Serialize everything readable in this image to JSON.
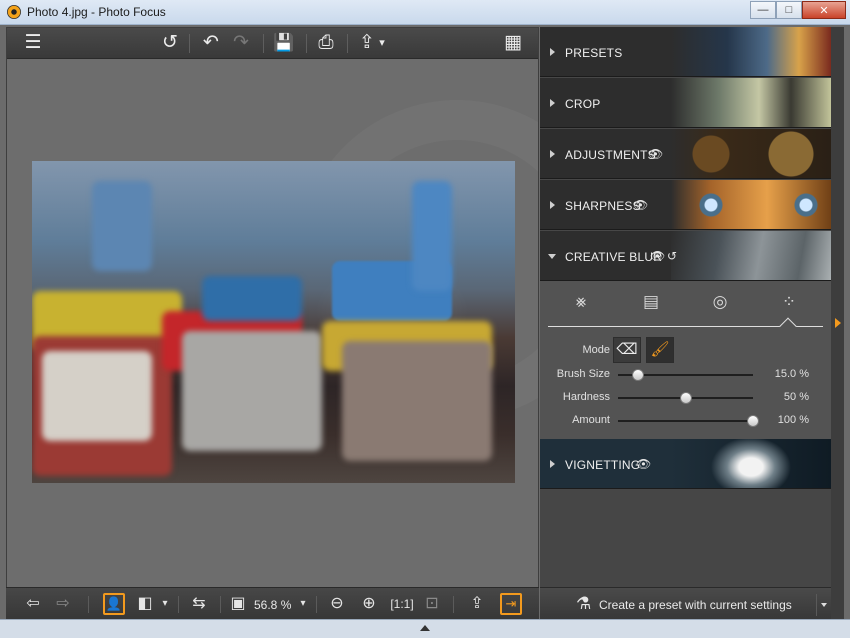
{
  "window": {
    "title": "Photo 4.jpg - Photo Focus",
    "controls": {
      "minimize": "—",
      "maximize": "□",
      "close": "✕"
    }
  },
  "toolbar": {
    "icons": [
      "menu-icon",
      "undo-all-icon",
      "undo-icon",
      "redo-icon",
      "save-icon",
      "print-icon",
      "share-icon",
      "grid-view-icon"
    ],
    "glyphs": {
      "menu": "☰",
      "undo_all": "↺",
      "undo": "↶",
      "redo": "↷",
      "save": "💾",
      "print": "⎙",
      "share": "⇪",
      "share_caret": "▾",
      "grid": "▦"
    }
  },
  "bottom_toolbar": {
    "glyphs": {
      "prev": "⇦",
      "next": "⇨",
      "person": "👤",
      "compare": "◧",
      "compare_caret": "▾",
      "split": "⇆",
      "frame": "▣",
      "zoom_caret": "▾",
      "zoom_out": "⊖",
      "zoom_in": "⊕",
      "actual": "[1:1]",
      "fit": "⊡",
      "export": "⇪",
      "exit": "⇥"
    },
    "zoom_value": "56.8 %"
  },
  "panels": {
    "presets": {
      "label": "PRESETS"
    },
    "crop": {
      "label": "CROP"
    },
    "adjustments": {
      "label": "ADJUSTMENTS",
      "eye": "👁"
    },
    "sharpness": {
      "label": "SHARPNESS",
      "eye": "👁"
    },
    "creative_blur": {
      "label": "CREATIVE BLUR",
      "eye": "👁",
      "reset": "↺"
    },
    "vignetting": {
      "label": "VIGNETTING",
      "eye": "👁"
    }
  },
  "blur_tools": {
    "mode_glyphs": {
      "radial": "⨳",
      "linear": "▤",
      "circle": "◎",
      "brush": "⁘"
    },
    "mode": {
      "label": "Mode",
      "eraser_glyph": "⌫",
      "brush_glyph": "🖌"
    },
    "brush_size": {
      "label": "Brush Size",
      "value_text": "15.0 %",
      "value": 15
    },
    "hardness": {
      "label": "Hardness",
      "value_text": "50 %",
      "value": 50
    },
    "amount": {
      "label": "Amount",
      "value_text": "100 %",
      "value": 100
    }
  },
  "preset_bar": {
    "label": "Create a preset with current settings",
    "icon_glyph": "⚗"
  },
  "colors": {
    "accent": "#f39a1e",
    "panel_bg": "#474747",
    "toolbar_bg": "#3a3a3a"
  }
}
